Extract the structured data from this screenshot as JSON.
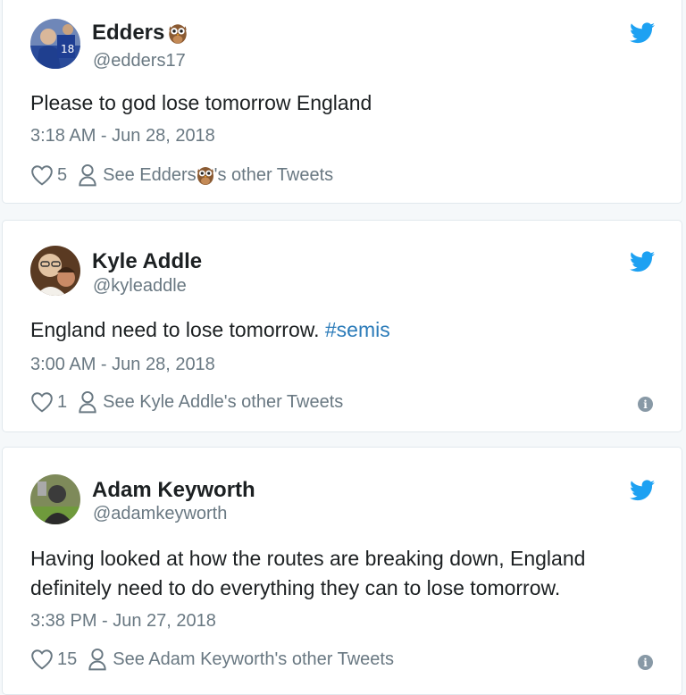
{
  "colors": {
    "twitter_blue": "#1da1f2",
    "text_primary": "#1c2022",
    "text_secondary": "#697882",
    "hashtag": "#2b7bb9",
    "card_border": "#e1e8ed"
  },
  "tweets": [
    {
      "name": "Edders",
      "name_emoji": "owl-icon",
      "handle": "@edders17",
      "text": "Please to god lose tomorrow England",
      "hashtag": "",
      "time": "3:18 AM - Jun 28, 2018",
      "likes": "5",
      "see_prefix": "See Edders",
      "see_suffix": "'s other Tweets"
    },
    {
      "name": "Kyle Addle",
      "handle": "@kyleaddle",
      "text": "England need to lose tomorrow.",
      "hashtag": "#semis",
      "time": "3:00 AM - Jun 28, 2018",
      "likes": "1",
      "see_text": "See Kyle Addle's other Tweets"
    },
    {
      "name": "Adam Keyworth",
      "handle": "@adamkeyworth",
      "text_line1": "Having looked at how the routes are breaking down, England",
      "text_line2": "definitely need to do everything they can to lose tomorrow.",
      "time": "3:38 PM - Jun 27, 2018",
      "likes": "15",
      "see_text": "See Adam Keyworth's other Tweets"
    }
  ],
  "icons": {
    "bird": "twitter-bird-icon",
    "heart": "heart-icon",
    "person": "person-icon",
    "info": "info-icon"
  },
  "info_glyph": "i"
}
